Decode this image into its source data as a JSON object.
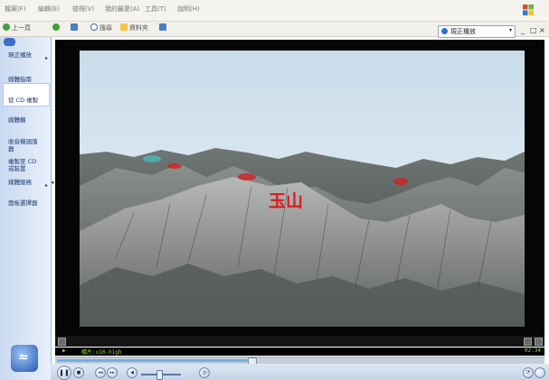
{
  "menubar": {
    "items": [
      "檔案(F)",
      "編輯(E)",
      "檢視(V)",
      "我的最愛(A)",
      "工具(T)",
      "說明(H)"
    ]
  },
  "toolbar": {
    "back_label": "上一頁",
    "search_label": "搜尋",
    "folders_label": "資料夾"
  },
  "now_playing": {
    "label": "現正播放",
    "arrow": "▾"
  },
  "window_controls": {
    "minimize": "_",
    "restore": "□",
    "close": "×"
  },
  "sidebar": {
    "items": [
      {
        "label": "現正播放",
        "arrow": "▸"
      },
      {
        "label": "媒體指南"
      },
      {
        "label": "從 CD 複製"
      },
      {
        "label": "媒體櫃"
      },
      {
        "label": "收音機調諧器"
      },
      {
        "label": "複製至 CD 或裝置"
      },
      {
        "label": "媒體服務",
        "arrow": "▸"
      },
      {
        "label": "面板選擇器"
      }
    ],
    "collapse_arrow": "◂"
  },
  "video": {
    "overlay_text": "玉山",
    "colors": {
      "sky_top": "#c9dcea",
      "sky_bottom": "#eef4f8",
      "label_red": "#d81b1b"
    }
  },
  "status": {
    "play_indicator": "▶",
    "clip_name": "檔片:x10-high",
    "time": "02:34"
  },
  "seek": {
    "progress": 0.4
  },
  "volume": {
    "level": 0.45
  },
  "transport": {
    "pause_glyph": "❚❚",
    "stop_glyph": "■",
    "prev_glyph": "◂◂",
    "next_glyph": "▸▸",
    "mute_glyph": "◀",
    "fullscreen_glyph": "◎",
    "shuffle_glyph": "⟳"
  },
  "icons": {
    "back": "back-arrow-icon",
    "forward": "forward-arrow-icon",
    "up": "up-folder-icon",
    "search": "search-icon",
    "folders": "folders-icon",
    "views": "views-icon",
    "windows_logo": "windows-logo-icon"
  }
}
